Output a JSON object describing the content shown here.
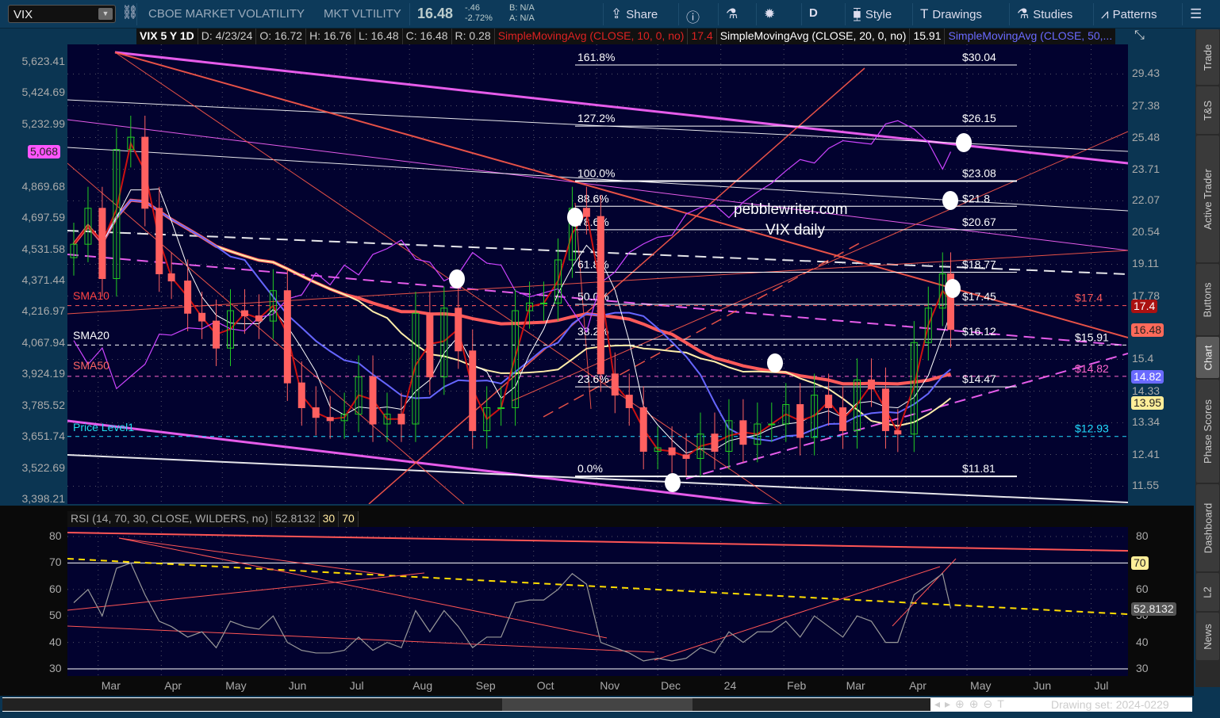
{
  "toolbar": {
    "symbol": "VIX",
    "description": "CBOE MARKET VOLATILITY",
    "short_name": "MKT VLTILITY",
    "last": "16.48",
    "change": "-.46",
    "change_pct": "-2.72%",
    "bid": "B: N/A",
    "ask": "A: N/A",
    "buttons": [
      {
        "label": "Share",
        "icon": "share-icon"
      },
      {
        "label": "",
        "icon": "info-icon"
      },
      {
        "label": "",
        "icon": "flask-icon"
      },
      {
        "label": "",
        "icon": "gear-icon"
      },
      {
        "label": "D",
        "icon": ""
      },
      {
        "label": "Style",
        "icon": "candlestick-icon"
      },
      {
        "label": "Drawings",
        "icon": "text-t-icon"
      },
      {
        "label": "Studies",
        "icon": "flask-icon"
      },
      {
        "label": "Patterns",
        "icon": "patterns-icon"
      },
      {
        "label": "",
        "icon": "menu-list-icon"
      }
    ]
  },
  "infobar": {
    "title": "VIX 5 Y 1D",
    "date": "D: 4/23/24",
    "open": "O: 16.72",
    "high": "H: 16.76",
    "low": "L: 16.48",
    "close": "C: 16.48",
    "range": "R: 0.28",
    "sma10": "SimpleMovingAvg (CLOSE, 10, 0, no)",
    "sma10_val": "17.4",
    "sma20": "SimpleMovingAvg (CLOSE, 20, 0, no)",
    "sma20_val": "15.91",
    "sma50": "SimpleMovingAvg (CLOSE, 50,..."
  },
  "colors": {
    "up": "#22cc22",
    "down": "#ff6060",
    "sma10": "#cc1111",
    "sma20": "#ffffff",
    "sma50": "#6666ff",
    "sma100": "#ffeeaa",
    "sma200": "#ff5a5a",
    "spx": "#cc44ff",
    "fib": "#ffffff",
    "trend": "#ff5a4a",
    "channel": "#ff66ff"
  },
  "chart_data": [
    {
      "type": "candlestick",
      "title": "",
      "scale": "log",
      "right_axis_ticks": [
        "29.43",
        "27.38",
        "25.48",
        "23.71",
        "22.07",
        "20.54",
        "19.11",
        "17.78",
        "15.4",
        "14.33",
        "13.34",
        "12.41",
        "11.55"
      ],
      "left_axis_ticks": [
        "5,623.41",
        "5,424.69",
        "5,232.99",
        "4,869.68",
        "4,697.59",
        "4,531.58",
        "4,371.44",
        "4,216.97",
        "4,067.94",
        "3,924.19",
        "3,785.52",
        "3,651.74",
        "3,522.69",
        "3,398.21"
      ],
      "x_ticks": [
        {
          "label": "Mar",
          "date": "2023-03-01"
        },
        {
          "label": "Apr",
          "date": "2023-04-01"
        },
        {
          "label": "May",
          "date": "2023-05-01"
        },
        {
          "label": "Jun",
          "date": "2023-06-01"
        },
        {
          "label": "Jul",
          "date": "2023-07-01"
        },
        {
          "label": "Aug",
          "date": "2023-08-01"
        },
        {
          "label": "Sep",
          "date": "2023-09-01"
        },
        {
          "label": "Oct",
          "date": "2023-10-01"
        },
        {
          "label": "Nov",
          "date": "2023-11-01"
        },
        {
          "label": "Dec",
          "date": "2023-12-01"
        },
        {
          "label": "24",
          "date": "2024-01-01"
        },
        {
          "label": "Feb",
          "date": "2024-02-01"
        },
        {
          "label": "Mar",
          "date": "2024-03-01"
        },
        {
          "label": "Apr",
          "date": "2024-04-01"
        },
        {
          "label": "May",
          "date": "2024-05-01"
        },
        {
          "label": "Jun",
          "date": "2024-06-01"
        },
        {
          "label": "Jul",
          "date": "2024-07-01"
        }
      ],
      "dates": [
        "2023-02-17",
        "2023-02-24",
        "2023-03-03",
        "2023-03-10",
        "2023-03-17",
        "2023-03-24",
        "2023-03-31",
        "2023-04-06",
        "2023-04-14",
        "2023-04-21",
        "2023-04-28",
        "2023-05-05",
        "2023-05-12",
        "2023-05-19",
        "2023-05-26",
        "2023-06-02",
        "2023-06-09",
        "2023-06-16",
        "2023-06-23",
        "2023-06-30",
        "2023-07-07",
        "2023-07-14",
        "2023-07-21",
        "2023-07-28",
        "2023-08-04",
        "2023-08-11",
        "2023-08-18",
        "2023-08-25",
        "2023-09-01",
        "2023-09-08",
        "2023-09-15",
        "2023-09-22",
        "2023-09-29",
        "2023-10-06",
        "2023-10-13",
        "2023-10-20",
        "2023-10-27",
        "2023-11-03",
        "2023-11-10",
        "2023-11-17",
        "2023-11-24",
        "2023-12-01",
        "2023-12-08",
        "2023-12-15",
        "2023-12-22",
        "2023-12-29",
        "2024-01-05",
        "2024-01-12",
        "2024-01-19",
        "2024-01-26",
        "2024-02-02",
        "2024-02-09",
        "2024-02-16",
        "2024-02-23",
        "2024-03-01",
        "2024-03-08",
        "2024-03-15",
        "2024-03-22",
        "2024-03-28",
        "2024-04-05",
        "2024-04-12",
        "2024-04-19",
        "2024-04-23"
      ],
      "vix_close": [
        20.0,
        21.7,
        18.5,
        24.8,
        25.5,
        21.7,
        18.7,
        18.4,
        17.1,
        16.8,
        15.8,
        17.2,
        17.0,
        16.8,
        18.0,
        14.6,
        13.8,
        13.5,
        13.4,
        13.6,
        14.8,
        13.3,
        13.6,
        13.3,
        17.1,
        14.8,
        17.3,
        15.7,
        13.1,
        13.8,
        13.8,
        17.2,
        17.5,
        17.5,
        19.3,
        21.7,
        21.3,
        14.9,
        14.2,
        13.8,
        12.5,
        12.6,
        12.4,
        12.3,
        13.0,
        12.5,
        13.4,
        12.7,
        13.3,
        13.3,
        13.9,
        12.9,
        14.2,
        13.8,
        13.1,
        14.7,
        14.4,
        13.1,
        13.0,
        16.0,
        17.3,
        18.7,
        16.48
      ],
      "spx_close": [
        4080,
        3970,
        4045,
        3860,
        3915,
        3970,
        4110,
        4105,
        4140,
        4135,
        4170,
        4135,
        4125,
        4190,
        4205,
        4280,
        4300,
        4410,
        4350,
        4450,
        4400,
        4505,
        4535,
        4580,
        4480,
        4465,
        4370,
        4405,
        4515,
        4460,
        4450,
        4320,
        4290,
        4310,
        4330,
        4225,
        4120,
        4360,
        4415,
        4515,
        4560,
        4595,
        4605,
        4720,
        4755,
        4770,
        4700,
        4785,
        4840,
        4890,
        4960,
        5025,
        5005,
        5090,
        5135,
        5125,
        5115,
        5235,
        5255,
        5205,
        5125,
        4970,
        5070
      ],
      "rsi": [
        55,
        60,
        50,
        68,
        70,
        58,
        48,
        46,
        42,
        44,
        38,
        48,
        46,
        45,
        50,
        40,
        37,
        36,
        36,
        37,
        42,
        37,
        40,
        38,
        52,
        44,
        52,
        46,
        38,
        42,
        42,
        55,
        56,
        56,
        60,
        66,
        62,
        40,
        38,
        36,
        33,
        34,
        33,
        34,
        38,
        36,
        44,
        40,
        44,
        44,
        48,
        42,
        50,
        46,
        42,
        50,
        48,
        40,
        40,
        58,
        62,
        66,
        52.8132
      ],
      "fib_levels": [
        {
          "pct": "161.8%",
          "price": "$30.04",
          "value": 30.04
        },
        {
          "pct": "127.2%",
          "price": "$26.15",
          "value": 26.15
        },
        {
          "pct": "100.0%",
          "price": "$23.08",
          "value": 23.08
        },
        {
          "pct": "88.6%",
          "price": "$21.8",
          "value": 21.8
        },
        {
          "pct": "78.6%",
          "price": "$20.67",
          "value": 20.67
        },
        {
          "pct": "61.8%",
          "price": "$18.77",
          "value": 18.77
        },
        {
          "pct": "50.0%",
          "price": "$17.45",
          "value": 17.45
        },
        {
          "pct": "38.2%",
          "price": "$16.12",
          "value": 16.12
        },
        {
          "pct": "23.6%",
          "price": "$14.47",
          "value": 14.47
        },
        {
          "pct": "0.0%",
          "price": "$11.81",
          "value": 11.81
        }
      ],
      "price_levels": [
        {
          "label": "$17.4",
          "value": 17.4,
          "color": "#ff5a5a"
        },
        {
          "label": "$15.91",
          "value": 15.91,
          "color": "#ffffff"
        },
        {
          "label": "$14.82",
          "value": 14.82,
          "color": "#ff66cc"
        },
        {
          "label": "$12.93",
          "value": 12.93,
          "color": "#22ddff"
        }
      ],
      "study_labels": {
        "sma10": "SMA10",
        "sma20": "SMA20",
        "sma50": "SMA50",
        "price_level": "Price Level1"
      },
      "annotation": {
        "line1": "pebblewriter.com",
        "line2": "VIX daily"
      },
      "right_tags": [
        {
          "label": "17.4",
          "bg": "#aa1111",
          "fg": "#fff"
        },
        {
          "label": "16.48",
          "bg": "#ff6a5a",
          "fg": "#222"
        },
        {
          "label": "14.82",
          "bg": "#6a6aff",
          "fg": "#fff"
        },
        {
          "label": "13.95",
          "bg": "#ffee99",
          "fg": "#222"
        }
      ],
      "left_tag": {
        "label": "5,068",
        "bg": "#ff55ff"
      }
    },
    {
      "type": "line",
      "title": "RSI (14, 70, 30, CLOSE, WILDERS, no)",
      "value": "52.8132",
      "oversold": "30",
      "overbought": "70",
      "y_ticks": [
        "80",
        "70",
        "60",
        "50",
        "40",
        "30"
      ],
      "ylim": [
        30,
        80
      ],
      "right_tag": "70"
    }
  ],
  "bottom": {
    "drawing_set": "Drawing set: 2024-0229"
  },
  "sidebar": {
    "tabs": [
      "Trade",
      "T&S",
      "Active Trader",
      "Buttons",
      "Chart",
      "Phase Scores",
      "Dashboard",
      "L2",
      "News"
    ],
    "selected": "Chart"
  }
}
